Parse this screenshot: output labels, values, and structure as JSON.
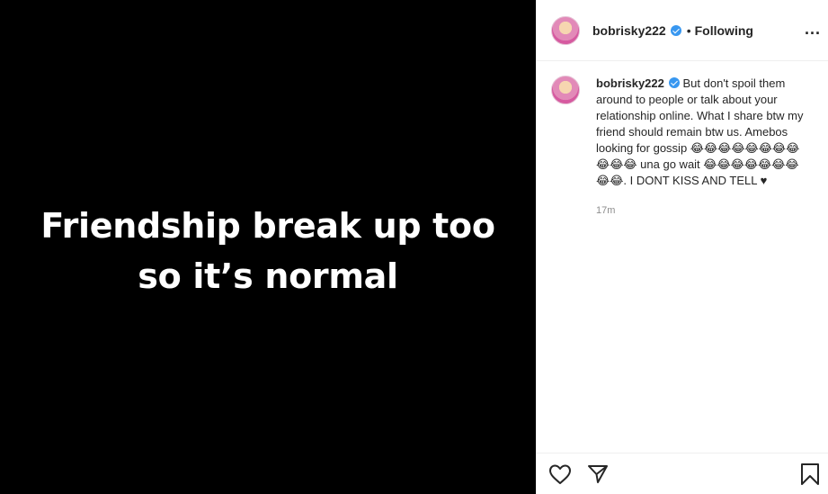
{
  "post": {
    "image_text_line1": "Friendship break up too",
    "image_text_line2": "so it’s normal"
  },
  "header": {
    "username": "bobrisky222",
    "separator": "•",
    "follow_status": "Following",
    "more_label": "..."
  },
  "caption": {
    "username": "bobrisky222",
    "text": "But don't spoil them around to people or talk about your relationship online. What I share btw my friend should remain btw us. Amebos looking for gossip 😂😂😂😂😂😂😂😂😂😂😂 una go wait 😂😂😂😂😂😂😂😂😂. I DONT KISS AND TELL ♥",
    "time": "17m"
  },
  "icons": {
    "like": "heart-icon",
    "share": "paper-plane-icon",
    "save": "bookmark-icon",
    "verified": "verified-badge-icon",
    "colors": {
      "verified": "#3897f0",
      "text": "#262626",
      "muted": "#8e8e8e"
    }
  }
}
